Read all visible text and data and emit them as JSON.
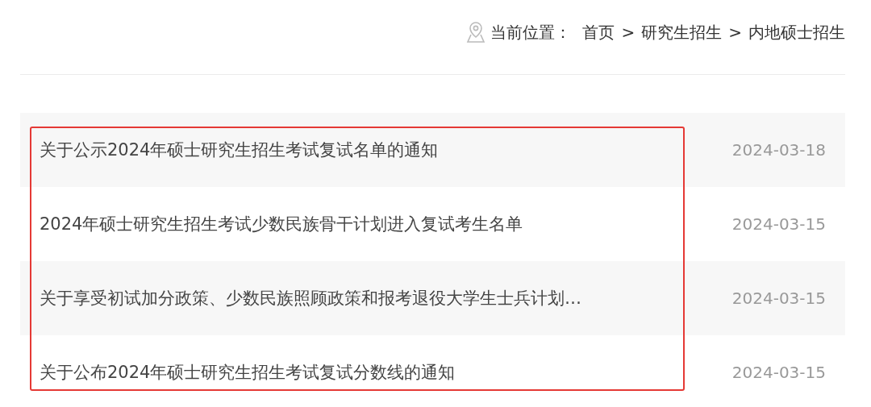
{
  "breadcrumb": {
    "label": "当前位置：",
    "items": [
      {
        "kind": "link",
        "text": "首页"
      },
      {
        "kind": "separator",
        "text": ">"
      },
      {
        "kind": "link",
        "text": "研究生招生"
      },
      {
        "kind": "separator",
        "text": ">"
      },
      {
        "kind": "link",
        "text": "内地硕士招生"
      }
    ]
  },
  "news": [
    {
      "title": "关于公示2024年硕士研究生招生考试复试名单的通知",
      "date": "2024-03-18"
    },
    {
      "title": "2024年硕士研究生招生考试少数民族骨干计划进入复试考生名单",
      "date": "2024-03-15"
    },
    {
      "title": "关于享受初试加分政策、少数民族照顾政策和报考退役大学生士兵计划…",
      "date": "2024-03-15"
    },
    {
      "title": "关于公布2024年硕士研究生招生考试复试分数线的通知",
      "date": "2024-03-15"
    }
  ]
}
